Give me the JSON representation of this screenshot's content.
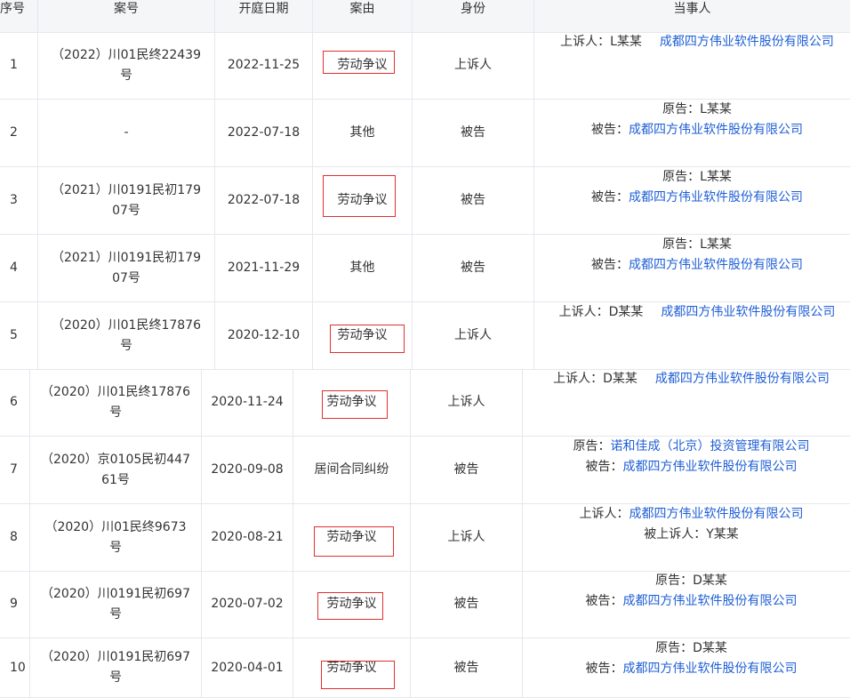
{
  "headers": {
    "seq": "序号",
    "case_no": "案号",
    "hearing_date": "开庭日期",
    "cause": "案由",
    "role": "身份",
    "parties": "当事人"
  },
  "colors": {
    "link": "#1f5fd6",
    "highlight_box": "#e03030",
    "border": "#e4e7ec",
    "header_bg": "#f5f6f8"
  },
  "rows": [
    {
      "seq": "1",
      "case_no": "（2022）川01民终22439号",
      "date": "2022-11-25",
      "cause": "劳动争议",
      "highlighted": true,
      "role": "上诉人",
      "parties": [
        {
          "label": "上诉人：",
          "name": "L某某",
          "company": "成都四方伟业软件股份有限公司"
        }
      ]
    },
    {
      "seq": "2",
      "case_no": "-",
      "date": "2022-07-18",
      "cause": "其他",
      "highlighted": false,
      "role": "被告",
      "parties": [
        {
          "label": "原告：",
          "name": "L某某"
        },
        {
          "label": "被告：",
          "company": "成都四方伟业软件股份有限公司"
        }
      ]
    },
    {
      "seq": "3",
      "case_no": "（2021）川0191民初17907号",
      "date": "2022-07-18",
      "cause": "劳动争议",
      "highlighted": true,
      "role": "被告",
      "parties": [
        {
          "label": "原告：",
          "name": "L某某"
        },
        {
          "label": "被告：",
          "company": "成都四方伟业软件股份有限公司"
        }
      ]
    },
    {
      "seq": "4",
      "case_no": "（2021）川0191民初17907号",
      "date": "2021-11-29",
      "cause": "其他",
      "highlighted": false,
      "role": "被告",
      "parties": [
        {
          "label": "原告：",
          "name": "L某某"
        },
        {
          "label": "被告：",
          "company": "成都四方伟业软件股份有限公司"
        }
      ]
    },
    {
      "seq": "5",
      "case_no": "（2020）川01民终17876号",
      "date": "2020-12-10",
      "cause": "劳动争议",
      "highlighted": true,
      "role": "上诉人",
      "parties": [
        {
          "label": "上诉人：",
          "name": "D某某",
          "company": "成都四方伟业软件股份有限公司"
        }
      ]
    },
    {
      "seq": "6",
      "case_no": "（2020）川01民终17876号",
      "date": "2020-11-24",
      "cause": "劳动争议",
      "highlighted": true,
      "role": "上诉人",
      "parties": [
        {
          "label": "上诉人：",
          "name": "D某某",
          "company": "成都四方伟业软件股份有限公司"
        }
      ]
    },
    {
      "seq": "7",
      "case_no": "（2020）京0105民初44761号",
      "date": "2020-09-08",
      "cause": "居间合同纠纷",
      "highlighted": false,
      "role": "被告",
      "parties": [
        {
          "label": "原告：",
          "company": "诺和佳成（北京）投资管理有限公司"
        },
        {
          "label": "被告：",
          "company": "成都四方伟业软件股份有限公司"
        }
      ]
    },
    {
      "seq": "8",
      "case_no": "（2020）川01民终9673号",
      "date": "2020-08-21",
      "cause": "劳动争议",
      "highlighted": true,
      "role": "上诉人",
      "parties": [
        {
          "label": "上诉人：",
          "company": "成都四方伟业软件股份有限公司"
        },
        {
          "label": "被上诉人：",
          "name": "Y某某"
        }
      ]
    },
    {
      "seq": "9",
      "case_no": "（2020）川0191民初697号",
      "date": "2020-07-02",
      "cause": "劳动争议",
      "highlighted": true,
      "role": "被告",
      "parties": [
        {
          "label": "原告：",
          "name": "D某某"
        },
        {
          "label": "被告：",
          "company": "成都四方伟业软件股份有限公司"
        }
      ]
    },
    {
      "seq": "10",
      "case_no": "（2020）川0191民初697号",
      "date": "2020-04-01",
      "cause": "劳动争议",
      "highlighted": true,
      "role": "被告",
      "parties": [
        {
          "label": "原告：",
          "name": "D某某"
        },
        {
          "label": "被告：",
          "company": "成都四方伟业软件股份有限公司"
        }
      ]
    }
  ]
}
